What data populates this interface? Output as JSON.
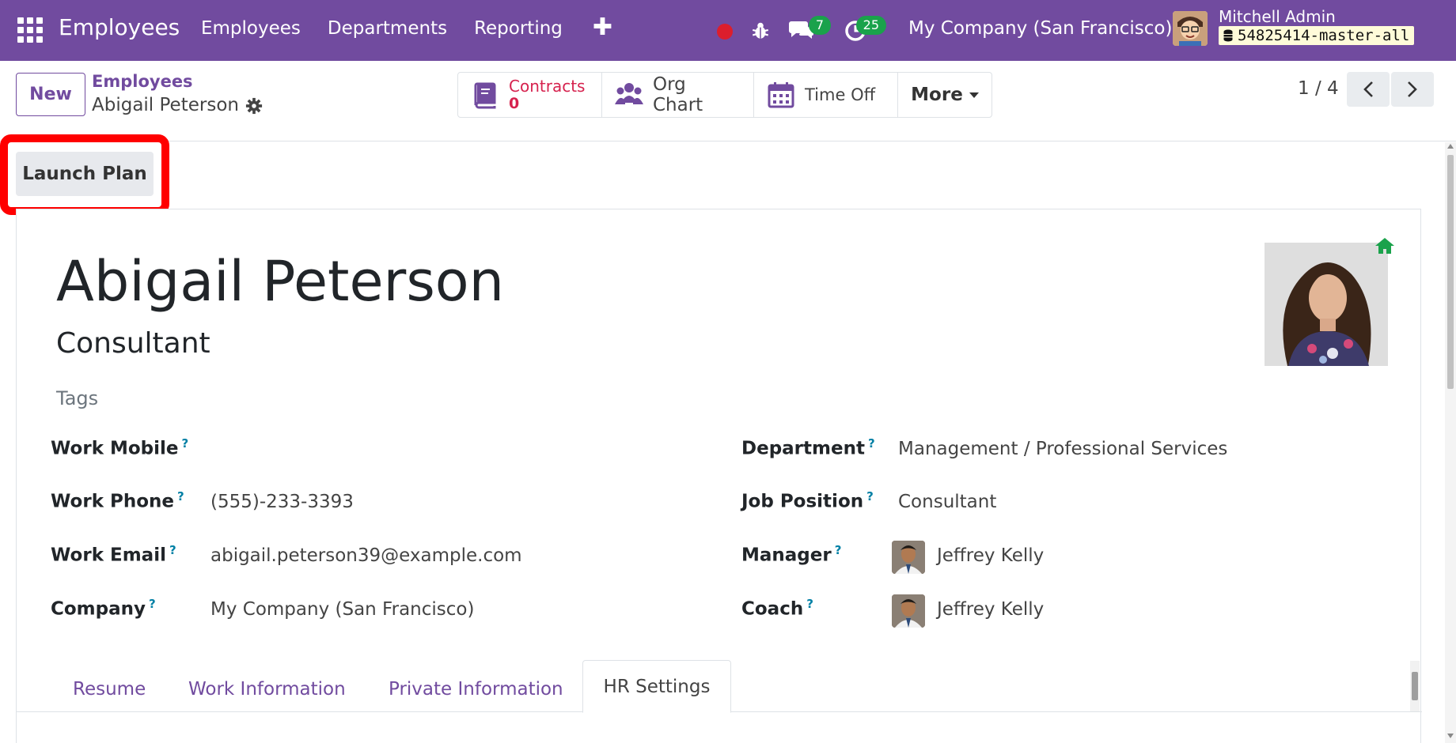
{
  "navbar": {
    "brand": "Employees",
    "menu": [
      "Employees",
      "Departments",
      "Reporting"
    ],
    "plus": "✚",
    "chat_count": "7",
    "activity_count": "25",
    "company": "My Company (San Francisco)",
    "user_name": "Mitchell Admin",
    "db_name": "54825414-master-all"
  },
  "control_panel": {
    "new_label": "New",
    "breadcrumb_parent": "Employees",
    "breadcrumb_current": "Abigail Peterson",
    "smart_buttons": {
      "contracts_label": "Contracts",
      "contracts_value": "0",
      "org_chart_label": "Org Chart",
      "time_off_label": "Time Off",
      "more_label": "More"
    },
    "pager": "1 / 4"
  },
  "actions": {
    "launch_plan": "Launch Plan"
  },
  "employee": {
    "name": "Abigail Peterson",
    "job_title": "Consultant",
    "tags_placeholder": "Tags"
  },
  "fields": {
    "work_mobile_label": "Work Mobile",
    "work_mobile_value": "",
    "work_phone_label": "Work Phone",
    "work_phone_value": "(555)-233-3393",
    "work_email_label": "Work Email",
    "work_email_value": "abigail.peterson39@example.com",
    "company_label": "Company",
    "company_value": "My Company (San Francisco)",
    "department_label": "Department",
    "department_value": "Management / Professional Services",
    "job_position_label": "Job Position",
    "job_position_value": "Consultant",
    "manager_label": "Manager",
    "manager_value": "Jeffrey Kelly",
    "coach_label": "Coach",
    "coach_value": "Jeffrey Kelly",
    "help_marker": "?"
  },
  "tabs": [
    "Resume",
    "Work Information",
    "Private Information",
    "HR Settings"
  ],
  "colors": {
    "brand": "#714B9F",
    "badge": "#1aa24b",
    "record": "#dc1e2c",
    "contracts": "#d6224e",
    "highlight": "#ff0000",
    "help": "#0180a5"
  }
}
